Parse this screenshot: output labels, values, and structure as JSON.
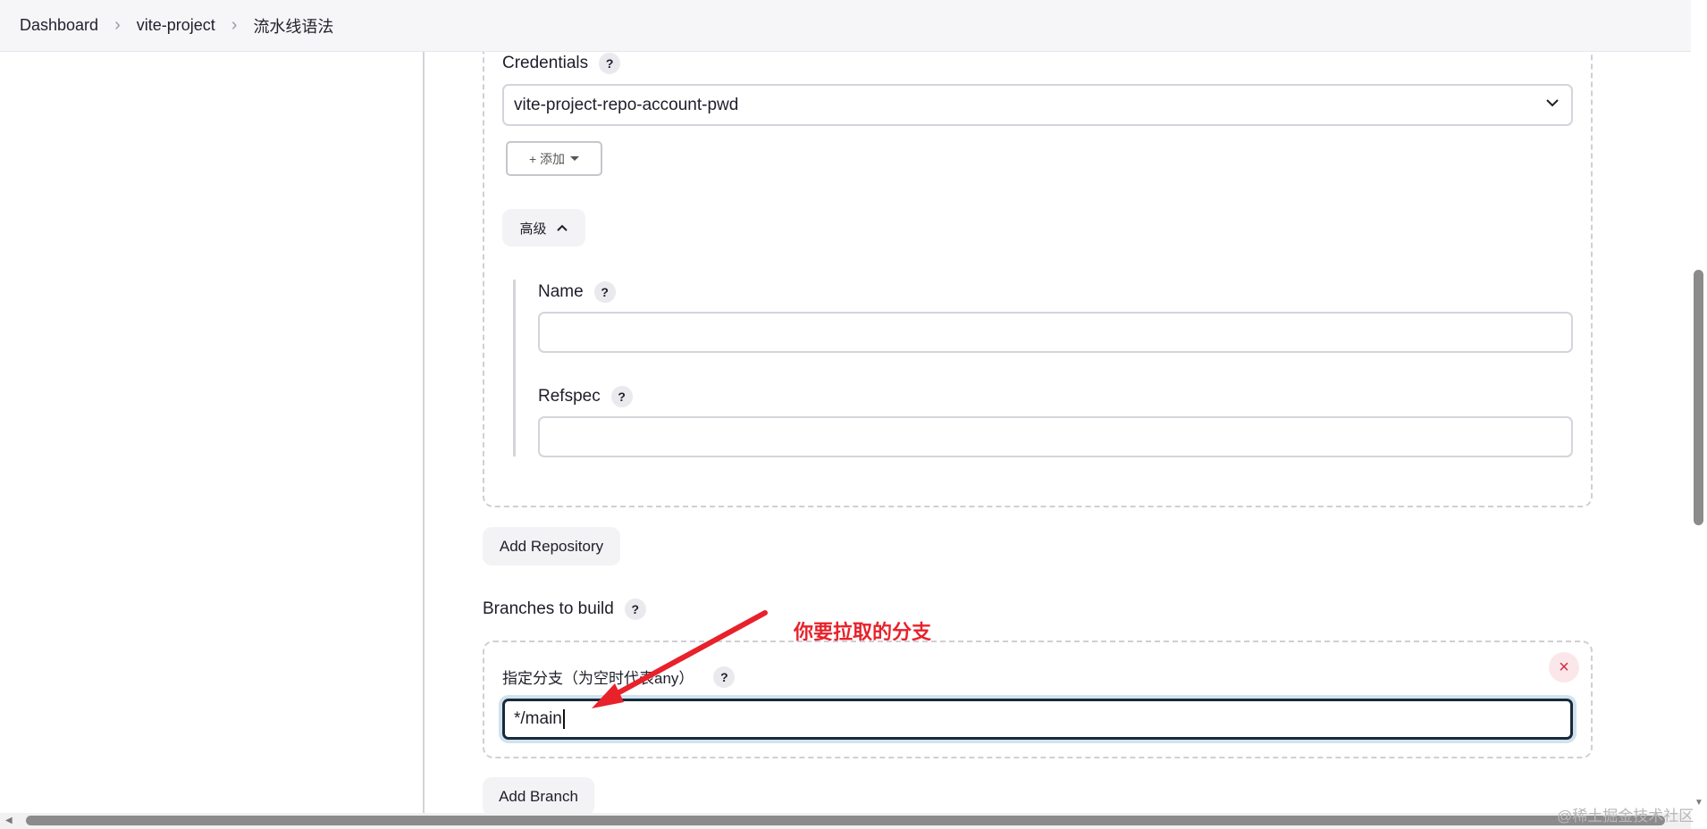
{
  "breadcrumb": [
    "Dashboard",
    "vite-project",
    "流水线语法"
  ],
  "credentials": {
    "label": "Credentials",
    "selected": "vite-project-repo-account-pwd",
    "add_button": "+ 添加"
  },
  "advanced": {
    "label": "高级"
  },
  "name_field": {
    "label": "Name",
    "value": ""
  },
  "refspec_field": {
    "label": "Refspec",
    "value": ""
  },
  "add_repository_button": "Add Repository",
  "branches": {
    "label": "Branches to build",
    "specifier_label": "指定分支（为空时代表any）",
    "specifier_value": "*/main",
    "delete_symbol": "×"
  },
  "add_branch_button": "Add Branch",
  "help_symbol": "?",
  "annotation": "你要拉取的分支",
  "watermark": "@稀土掘金技术社区",
  "colors": {
    "annotation": "#e8212a",
    "focus_border": "#1a2a3a",
    "delete": "#d22a45"
  }
}
